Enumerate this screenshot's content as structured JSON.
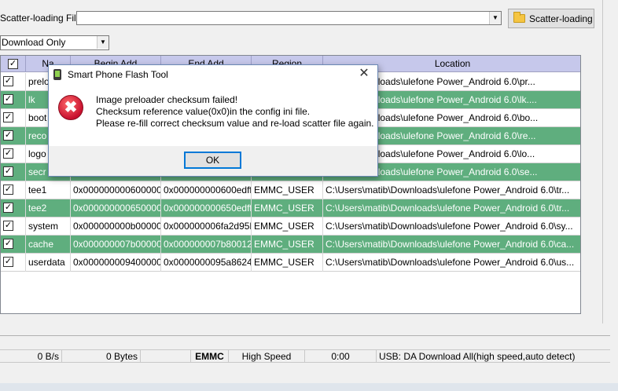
{
  "scatter": {
    "label": "Scatter-loading File",
    "value": "",
    "button": "Scatter-loading"
  },
  "mode": {
    "selected": "Download Only"
  },
  "table": {
    "headers": {
      "check": "",
      "name": "Na",
      "begin": "Begin Add",
      "end": "End Add",
      "region": "Region",
      "location": "Location"
    },
    "rows": [
      {
        "name": "prelo",
        "begin": "",
        "end": "",
        "region": "",
        "location": "\\matib\\Downloads\\ulefone Power_Android 6.0\\pr..."
      },
      {
        "name": "lk",
        "begin": "",
        "end": "",
        "region": "",
        "location": "\\matib\\Downloads\\ulefone Power_Android 6.0\\lk...."
      },
      {
        "name": "boot",
        "begin": "",
        "end": "",
        "region": "",
        "location": "\\matib\\Downloads\\ulefone Power_Android 6.0\\bo..."
      },
      {
        "name": "reco",
        "begin": "",
        "end": "",
        "region": "",
        "location": "\\matib\\Downloads\\ulefone Power_Android 6.0\\re..."
      },
      {
        "name": "logo",
        "begin": "",
        "end": "",
        "region": "",
        "location": "\\matib\\Downloads\\ulefone Power_Android 6.0\\lo..."
      },
      {
        "name": "secr",
        "begin": "",
        "end": "",
        "region": "",
        "location": "\\matib\\Downloads\\ulefone Power_Android 6.0\\se..."
      },
      {
        "name": "tee1",
        "begin": "0x0000000006000000",
        "end": "0x000000000600edff",
        "region": "EMMC_USER",
        "location": "C:\\Users\\matib\\Downloads\\ulefone Power_Android 6.0\\tr..."
      },
      {
        "name": "tee2",
        "begin": "0x0000000006500000",
        "end": "0x000000000650edff",
        "region": "EMMC_USER",
        "location": "C:\\Users\\matib\\Downloads\\ulefone Power_Android 6.0\\tr..."
      },
      {
        "name": "system",
        "begin": "0x000000000b000000",
        "end": "0x000000006fa2d95b",
        "region": "EMMC_USER",
        "location": "C:\\Users\\matib\\Downloads\\ulefone Power_Android 6.0\\sy..."
      },
      {
        "name": "cache",
        "begin": "0x000000007b000000",
        "end": "0x000000007b80012f",
        "region": "EMMC_USER",
        "location": "C:\\Users\\matib\\Downloads\\ulefone Power_Android 6.0\\ca..."
      },
      {
        "name": "userdata",
        "begin": "0x0000000094000000",
        "end": "0x0000000095a8624f",
        "region": "EMMC_USER",
        "location": "C:\\Users\\matib\\Downloads\\ulefone Power_Android 6.0\\us..."
      }
    ]
  },
  "status": {
    "speed": "0 B/s",
    "bytes": "0 Bytes",
    "storage": "EMMC",
    "mode": "High Speed",
    "time": "0:00",
    "usb": "USB: DA Download All(high speed,auto detect)"
  },
  "dialog": {
    "title": "Smart Phone Flash Tool",
    "close": "✕",
    "error_icon": "✖",
    "line1": "Image preloader checksum failed!",
    "line2": "Checksum reference value(0x0)in the config ini file.",
    "line3": "Please re-fill correct checksum value and re-load scatter file again.",
    "ok": "OK"
  }
}
